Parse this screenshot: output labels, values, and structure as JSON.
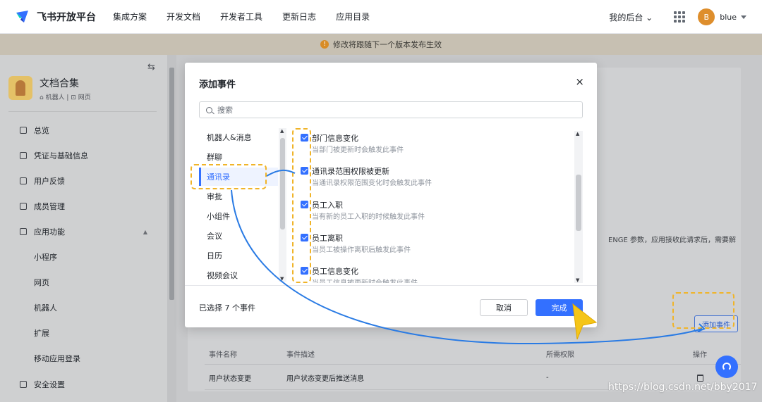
{
  "topnav": {
    "brand": "飞书开放平台",
    "items": [
      "集成方案",
      "开发文档",
      "开发者工具",
      "更新日志",
      "应用目录"
    ],
    "backend": "我的后台",
    "avatar_letter": "B",
    "username": "blue"
  },
  "notice": {
    "text": "修改将跟随下一个版本发布生效",
    "icon_glyph": "!"
  },
  "sidebar": {
    "collapse_glyph": "⇆",
    "app_name": "文档合集",
    "app_tags": "⌂ 机器人 | ⊡ 网页",
    "items": [
      "总览",
      "凭证与基础信息",
      "用户反馈",
      "成员管理",
      "应用功能",
      "小程序",
      "网页",
      "机器人",
      "扩展",
      "移动应用登录",
      "安全设置"
    ],
    "expand_glyph": "▲"
  },
  "background": {
    "partial_text": "ENGE 参数，应用接收此请求后，需要解",
    "add_event_button": "添加事件",
    "table_headers": [
      "事件名称",
      "事件描述",
      "所需权限",
      "操作"
    ],
    "table_rows": [
      {
        "name": "用户状态变更",
        "desc": "用户状态变更后推送消息",
        "perm": "-"
      }
    ]
  },
  "modal": {
    "title": "添加事件",
    "close_glyph": "×",
    "search_placeholder": "搜索",
    "categories": [
      "机器人&消息",
      "群聊",
      "通讯录",
      "审批",
      "小组件",
      "会议",
      "日历",
      "视频会议"
    ],
    "active_category": "通讯录",
    "scroll_up_glyph": "▲",
    "scroll_down_glyph": "▼",
    "events": [
      {
        "title": "部门信息变化",
        "desc": "当部门被更新时会触发此事件"
      },
      {
        "title": "通讯录范围权限被更新",
        "desc": "当通讯录权限范围变化时会触发此事件"
      },
      {
        "title": "员工入职",
        "desc": "当有新的员工入职的时候触发此事件"
      },
      {
        "title": "员工离职",
        "desc": "当员工被操作离职后触发此事件"
      },
      {
        "title": "员工信息变化",
        "desc": "当员工信息被更新时会触发此事件"
      }
    ],
    "selected_count": "已选择 7 个事件",
    "cancel_label": "取消",
    "done_label": "完成"
  },
  "watermark": "https://blog.csdn.net/bby2017",
  "colors": {
    "primary": "#3370ff",
    "annotation": "#f0b429",
    "arrow": "#2a7be4"
  }
}
